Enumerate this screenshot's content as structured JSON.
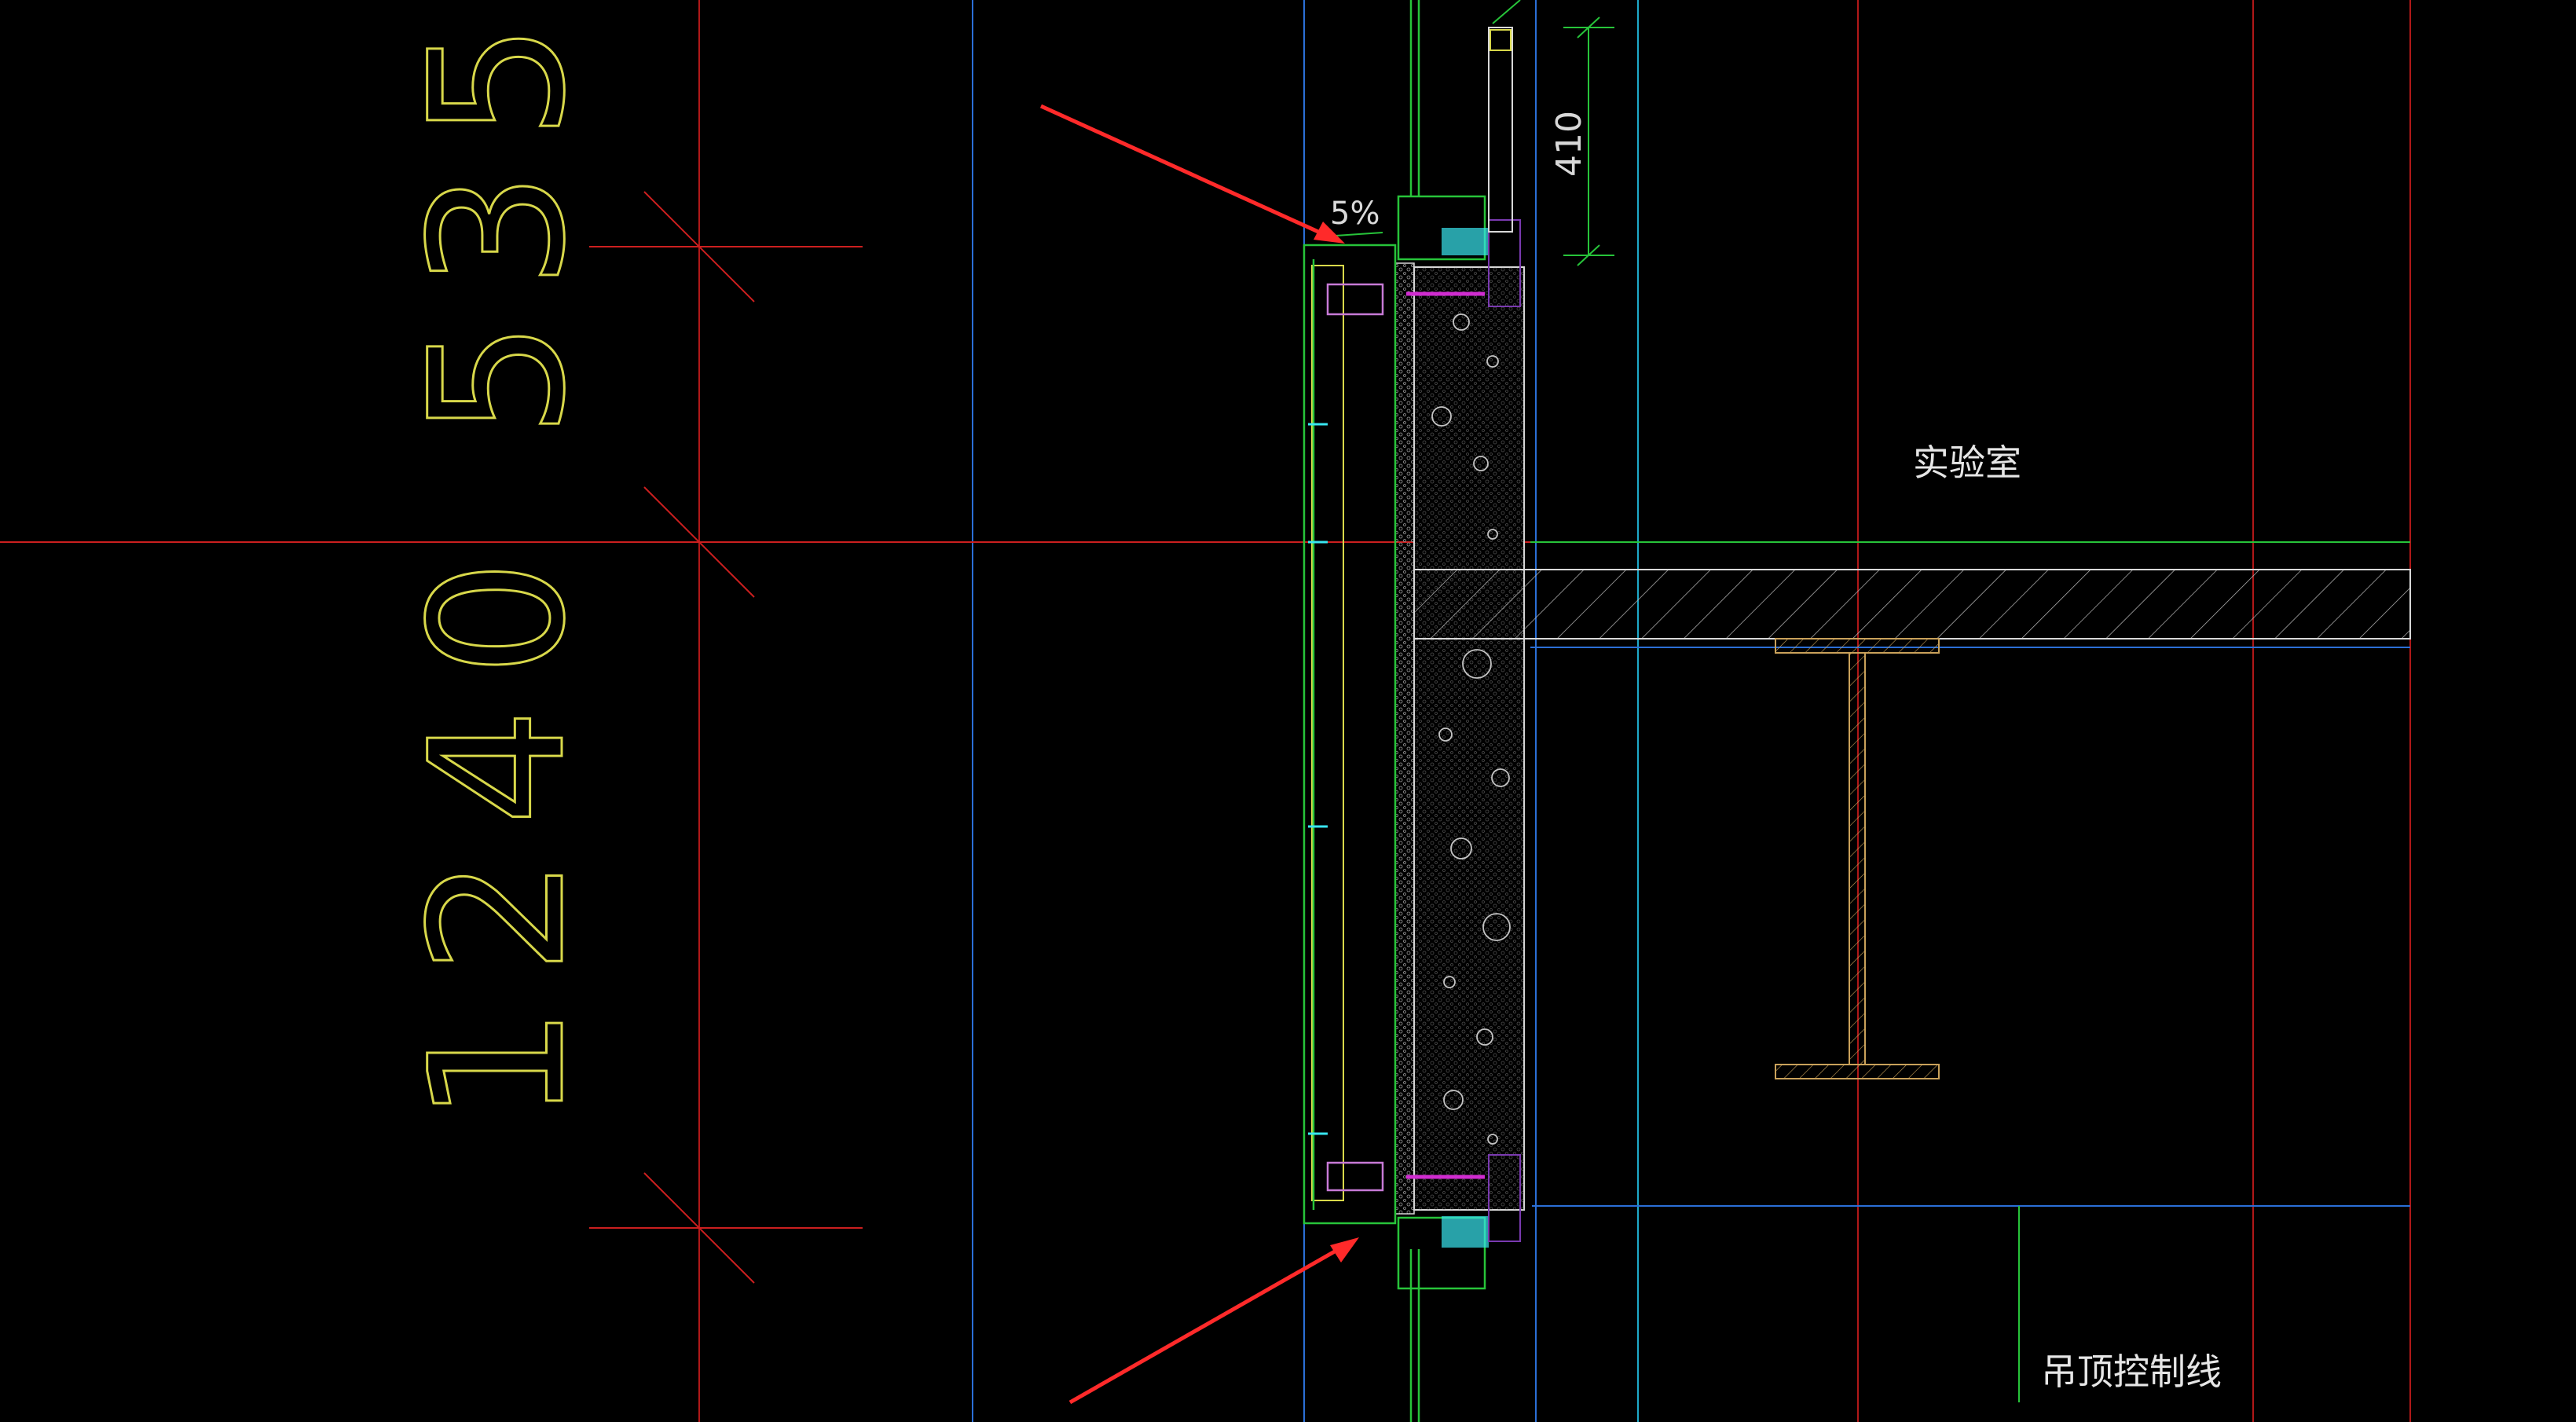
{
  "drawing": {
    "dimension_vertical": "1240 535",
    "dimension_small": "410",
    "slope_label": "5%",
    "room_label": "实验室",
    "ceiling_label": "吊顶控制线"
  },
  "colors": {
    "background": "#000000",
    "axis_red": "#cc1f1f",
    "dim_yellow": "#d8d84a",
    "frame_green": "#27c43a",
    "grid_blue": "#2b6fd6",
    "grid_cyan": "#1ea9c9",
    "arrow_red": "#ff2a2a",
    "hatch_white": "#cfcfcf",
    "magenta": "#d02cd0",
    "accent_cyan": "#39e6f0"
  }
}
